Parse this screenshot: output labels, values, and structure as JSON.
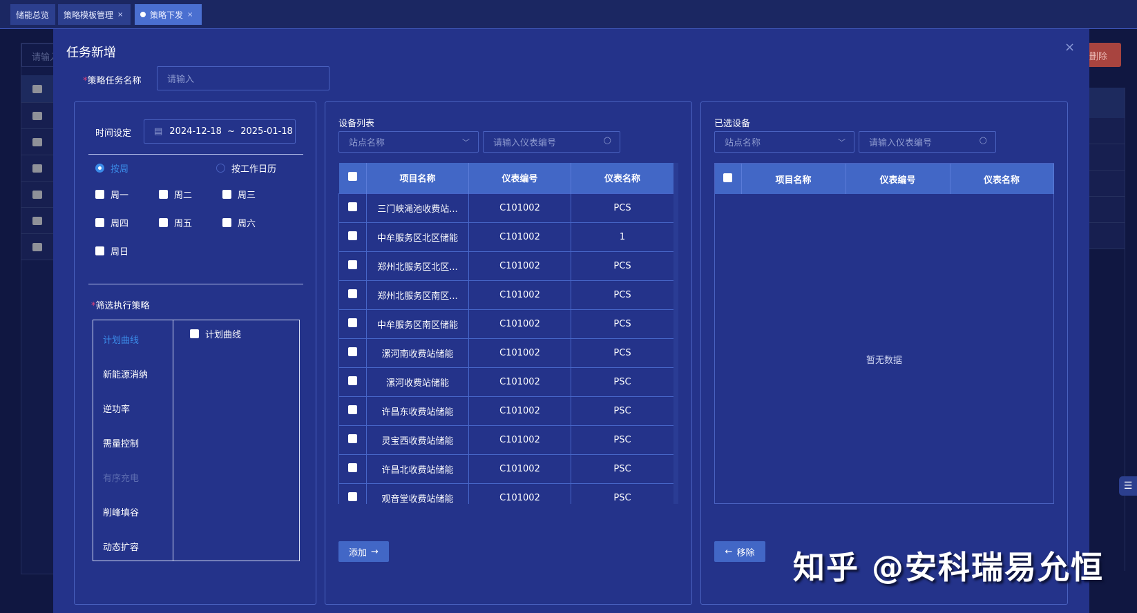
{
  "tabs": [
    {
      "label": "储能总览",
      "closable": false,
      "active": false
    },
    {
      "label": "策略模板管理",
      "closable": true,
      "active": false
    },
    {
      "label": "策略下发",
      "closable": true,
      "active": true
    }
  ],
  "tab_close": "×",
  "background": {
    "search_placeholder": "请输入",
    "delete_label": "删除"
  },
  "modal": {
    "title": "任务新增",
    "close": "×",
    "name_label": "策略任务名称",
    "required": "*",
    "name_placeholder": "请输入",
    "time": {
      "label": "时间设定",
      "range": "2024-12-18  ~  2025-01-18"
    },
    "radios": [
      {
        "label": "按周",
        "checked": true
      },
      {
        "label": "按工作日历",
        "checked": false
      }
    ],
    "weekdays": [
      "周一",
      "周二",
      "周三",
      "周四",
      "周五",
      "周六",
      "周日"
    ],
    "strategy_label": "筛选执行策略",
    "strategies": [
      {
        "label": "计划曲线",
        "state": "active"
      },
      {
        "label": "新能源消纳",
        "state": "normal"
      },
      {
        "label": "逆功率",
        "state": "normal"
      },
      {
        "label": "需量控制",
        "state": "normal"
      },
      {
        "label": "有序充电",
        "state": "disabled"
      },
      {
        "label": "削峰填谷",
        "state": "normal"
      },
      {
        "label": "动态扩容",
        "state": "normal"
      }
    ],
    "strategy_options": [
      "计划曲线"
    ],
    "device_list": {
      "title": "设备列表",
      "site_placeholder": "站点名称",
      "meter_placeholder": "请输入仪表编号",
      "columns": [
        "项目名称",
        "仪表编号",
        "仪表名称"
      ],
      "rows": [
        [
          "三门峡渑池收费站...",
          "C101002",
          "PCS"
        ],
        [
          "中牟服务区北区储能",
          "C101002",
          "1"
        ],
        [
          "郑州北服务区北区...",
          "C101002",
          "PCS"
        ],
        [
          "郑州北服务区南区...",
          "C101002",
          "PCS"
        ],
        [
          "中牟服务区南区储能",
          "C101002",
          "PCS"
        ],
        [
          "漯河南收费站储能",
          "C101002",
          "PCS"
        ],
        [
          "漯河收费站储能",
          "C101002",
          "PSC"
        ],
        [
          "许昌东收费站储能",
          "C101002",
          "PSC"
        ],
        [
          "灵宝西收费站储能",
          "C101002",
          "PSC"
        ],
        [
          "许昌北收费站储能",
          "C101002",
          "PSC"
        ],
        [
          "观音堂收费站储能",
          "C101002",
          "PSC"
        ]
      ],
      "add_label": "添加"
    },
    "selected": {
      "title": "已选设备",
      "site_placeholder": "站点名称",
      "meter_placeholder": "请输入仪表编号",
      "columns": [
        "项目名称",
        "仪表编号",
        "仪表名称"
      ],
      "empty": "暂无数据",
      "remove_label": "移除"
    }
  },
  "watermark": "知乎 @安科瑞易允恒"
}
